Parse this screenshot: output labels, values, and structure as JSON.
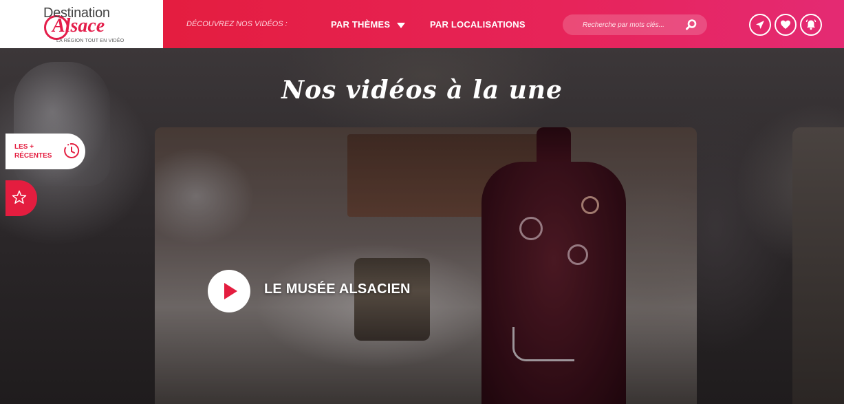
{
  "header": {
    "logo": {
      "line1": "Destination",
      "line2": "Alsace",
      "tagline": "LA RÉGION TOUT EN VIDÉO"
    },
    "intro": "DÉCOUVREZ NOS VIDÉOS :",
    "nav": {
      "themes_label": "PAR THÈMES",
      "locations_label": "PAR LOCALISATIONS"
    },
    "search": {
      "placeholder": "Recherche par mots clés..."
    },
    "icons": [
      "send-icon",
      "heart-icon",
      "bell-icon"
    ]
  },
  "hero": {
    "title": "Nos vidéos à la une",
    "featured_video": {
      "title": "LE MUSÉE ALSACIEN"
    }
  },
  "side_tabs": {
    "recent_label": "LES + RÉCENTES",
    "recent_icon": "clock-icon",
    "star_icon": "star-icon"
  },
  "colors": {
    "brand_red": "#e41d3f",
    "brand_pink": "#e42a73",
    "white": "#ffffff"
  }
}
